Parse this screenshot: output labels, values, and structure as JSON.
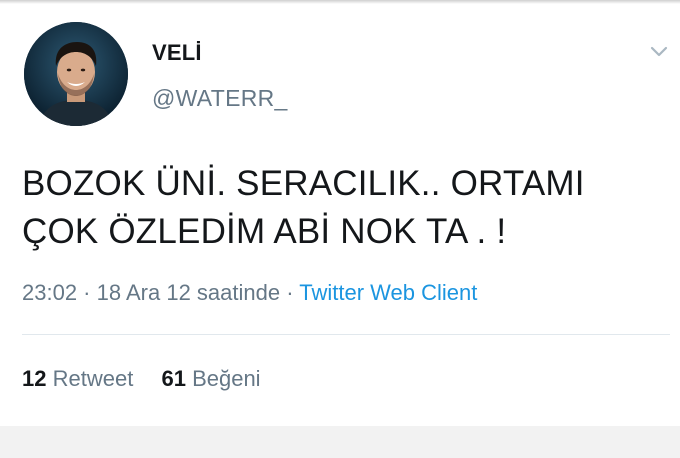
{
  "user": {
    "display_name": "VELİ",
    "handle": "@WATERR_"
  },
  "tweet": {
    "lines": [
      "BOZOK ÜNİ. SERACILIK.. ORTAMI",
      "ÇOK ÖZLEDİM ABİ NOK TA . !"
    ]
  },
  "meta": {
    "time": "23:02",
    "separator": " · ",
    "date": "18 Ara 12 saatinde",
    "separator2": " · ",
    "source": "Twitter Web Client"
  },
  "stats": {
    "retweet_count": "12",
    "retweet_label": "Retweet",
    "like_count": "61",
    "like_label": "Beğeni"
  },
  "colors": {
    "text_primary": "#14171a",
    "text_secondary": "#657786",
    "link": "#1b95e0",
    "divider": "#e1e8ed"
  },
  "icons": {
    "menu": "chevron-down-icon",
    "avatar": "profile-photo"
  }
}
